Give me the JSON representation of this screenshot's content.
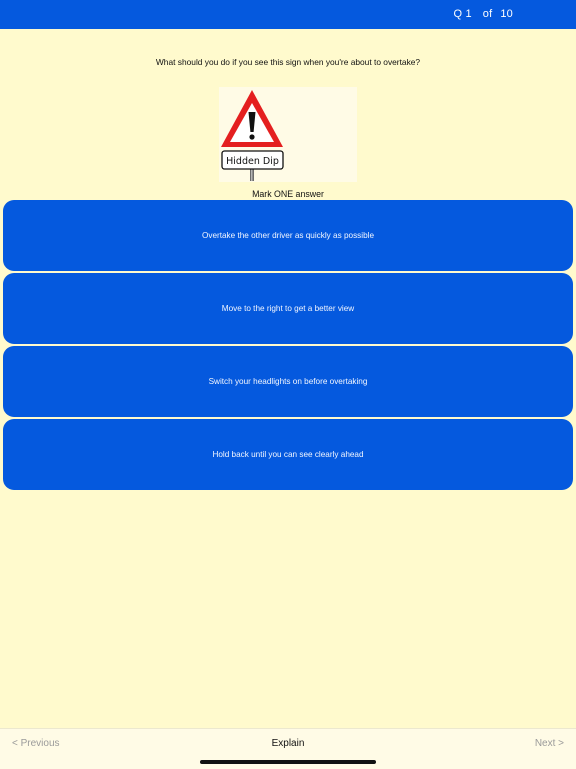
{
  "header": {
    "q_label": "Q 1",
    "of_label": "of",
    "total": "10"
  },
  "question": {
    "text": "What should you do if you see this sign when you're about to overtake?",
    "sign_text": "Hidden Dip",
    "sign_icon": "warning-triangle-icon"
  },
  "instruction": "Mark ONE answer",
  "answers": [
    "Overtake the other driver as quickly as possible",
    "Move to the right to get a better view",
    "Switch your headlights on before overtaking",
    "Hold back until you can see clearly ahead"
  ],
  "footer": {
    "previous": "< Previous",
    "explain": "Explain",
    "next": "Next >"
  },
  "colors": {
    "accent": "#0559de",
    "background": "#fffacd",
    "sign_red": "#e41f1f"
  }
}
